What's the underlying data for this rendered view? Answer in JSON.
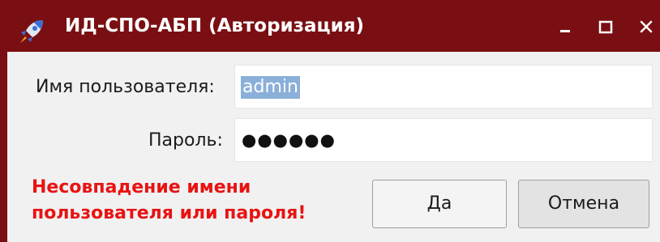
{
  "window": {
    "title": "ИД-СПО-АБП (Авторизация)",
    "controls": {
      "minimize": "minimize-icon",
      "maximize": "maximize-icon",
      "close": "close-icon"
    },
    "app_icon": "rocket-icon",
    "title_bar_color": "#7a0f13"
  },
  "form": {
    "username_label": "Имя пользователя:",
    "username_value": "admin",
    "password_label": "Пароль:",
    "password_masked": "●●●●●●"
  },
  "error": {
    "line1": "Несовпадение имени",
    "line2": "пользователя или пароля!",
    "color": "#e81313"
  },
  "buttons": {
    "ok_label": "Да",
    "cancel_label": "Отмена"
  }
}
